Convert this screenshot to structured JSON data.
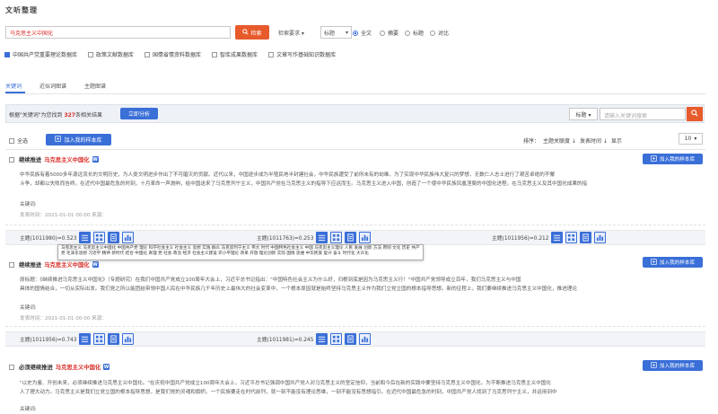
{
  "header": {
    "title": "文听整理",
    "search_value": "马克思主义中国化",
    "search_button": "检索",
    "advanced_search": "检索要求 ▾",
    "scope_value": "标题",
    "radio_options": [
      "全文",
      "摘要",
      "标题",
      "对比"
    ],
    "radio_selected": "全文"
  },
  "databases": [
    {
      "label": "中国共产党重要理论数据库",
      "checked": true
    },
    {
      "label": "政策文献数据库",
      "checked": false
    },
    {
      "label": "国情省情资料数据库",
      "checked": false
    },
    {
      "label": "智库成果数据库",
      "checked": false
    },
    {
      "label": "文章写作基础知识数据库",
      "checked": false
    }
  ],
  "tabs": [
    {
      "label": "关键词",
      "active": true
    },
    {
      "label": "近似词图谱",
      "active": false
    },
    {
      "label": "主题图谱",
      "active": false
    }
  ],
  "summary": {
    "prefix": "根据\"关键词\"为您找到",
    "count": "327",
    "suffix": "条相关结果",
    "analyze_button": "立即分析",
    "field_select": "标题 ▾",
    "kw_placeholder": "请输入关键词搜索"
  },
  "toolbar": {
    "select_all": "全选",
    "add_all": "加入我的样本库",
    "sort_label": "排序：",
    "sort_relevance": "主题关联度 ↓",
    "sort_time": "发表时间 ↓",
    "per_page_label": "显示",
    "page_size": "10"
  },
  "results": [
    {
      "title_prefix": "继续推进",
      "title_highlight": "马克思主义中国化",
      "badge": "W",
      "add_button": "加入我的样本库",
      "abstract_line1": "中华民族有着5000多年源远流长的文明历史，为人类文明进步作出了不可磨灭的贡献。近代以来，中国逐步成为半殖民地半封建社会，中华民族遭受了前所未有的劫难。为了实现中华民族伟大复兴的梦想，无数仁人志士进行了艰苦卓绝的不懈",
      "abstract_line2": "斗争，却都以失败而告终。在近代中国最危急的时刻，十月革命一声炮响，给中国送来了马克思列宁主义，中国共产党在马克思主义的指导下应运而生。马克思主义进入中国，创造了一个使中华民族凤凰涅槃的中国化进程。在马克思主义及其中国化成果的指",
      "keywords_label": "关键词:",
      "publish_time": "发表时间：2021-01-01 00:00  来源：",
      "topics": [
        "主题(1011980)=0.523",
        "主题(1011763)=0.253",
        "主题(1011956)=0.212"
      ]
    },
    {
      "title_prefix": "继续推进",
      "title_highlight": "马克思主义中国化",
      "badge": "W",
      "add_button": "加入我的样本库",
      "abstract_line1": "原标题：《继续推进马克思主义中国化》（专题研究）在我们中国共产党成立100周年大会上，习近平总书记指出：\"中国特色社会主义为什么好，归根到底是因为马克思主义行！\"中国共产党领导成立百年，我们马克思主义与中国",
      "abstract_line2": "具体的国情结合，一切从实际出发。我们党之所以能团结带领中国人民在中华民族几千年历史上最伟大的社会变革中，一个根本原因就是始终坚持马克思主义作为我们立党立国的根本指导思想。新的征程上，我们要继续推进马克思主义中国化，推进理论",
      "keywords_label": "关键词:",
      "publish_time": "发表时间：2021-01-01 00:00  来源：",
      "topics": [
        "主题(1011956)=0.743",
        "主题(1011981)=0.245"
      ]
    },
    {
      "title_prefix": "必须继续推进",
      "title_highlight": "马克思主义中国化",
      "badge": "W",
      "add_button": "加入我的样本库",
      "abstract_line1": "\"以史为鉴、开创未来，必须继续推进马克思主义中国化。\"在庆祝中国共产党成立100周年大会上，习近平总书记强调中国共产党人对马克思主义的坚定信仰，当前和今后在新的实践中要坚持马克思主义中国化，为不断推进马克思主义中国化",
      "abstract_line2": "人了理大动力。马克思主义是我们立党立国的根本指导思想，是我们党的灵魂和旗帜。一个民族要走在时代前列，就一刻不能没有理论思维，一刻不能没有思想指引。在近代中国最危急的时刻，中国共产党人找到了马克思列宁主义，并运用到中",
      "keywords_label": "关键词:",
      "publish_time": "",
      "topics": []
    }
  ],
  "tooltip": "马克思主义 马克思主义中国化 中国共产党 理论 科学社会主义 社会主义 思想 实践 群众 马克思列宁主义 伟大 时代 中国特色社会主义 中国 马克思主义理论 人民 发展 创新 方法 原则 文化 历史 共产党 毛泽东思想 习近平 精神 新时代 结合 中国化 真理 党 社会 政治 经济 社会主义建设 邓小平理论 改革 开放 理论创新 实际 国情 思维 中华民族 复兴 奋斗 时代化 大众化",
  "colors": {
    "accent": "#3a6fd8",
    "search_button": "#e75a2b",
    "highlight": "#d9302a"
  }
}
